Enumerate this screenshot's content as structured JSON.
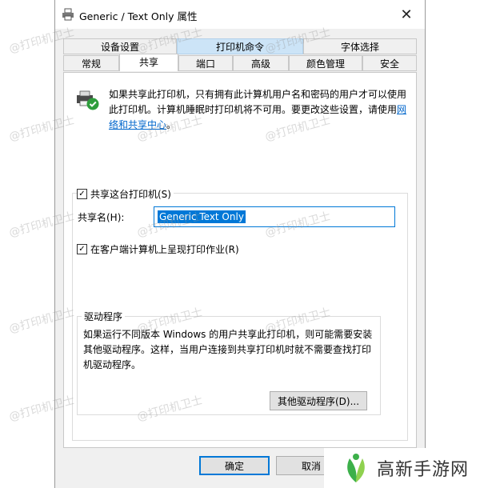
{
  "window": {
    "title": "Generic / Text Only 属性",
    "close_glyph": "✕"
  },
  "tabs": {
    "row1": [
      "设备设置",
      "打印机命令",
      "字体选择"
    ],
    "row2": [
      "常规",
      "共享",
      "端口",
      "高级",
      "颜色管理",
      "安全"
    ],
    "active": "共享",
    "highlighted": "打印机命令"
  },
  "intro": {
    "text": "如果共享此打印机，只有拥有此计算机用户名和密码的用户才可以使用此打印机。计算机睡眠时打印机将不可用。要更改这些设置，请使用",
    "link": "网络和共享中心",
    "suffix": "。"
  },
  "share": {
    "checkbox_label": "共享这台打印机(S)",
    "checked": true,
    "name_label": "共享名(H):",
    "name_value": "Generic  Text Only"
  },
  "render": {
    "checkbox_label": "在客户端计算机上呈现打印作业(R)",
    "checked": true
  },
  "driver": {
    "legend": "驱动程序",
    "text": "如果运行不同版本 Windows 的用户共享此打印机，则可能需要安装其他驱动程序。这样，当用户连接到共享打印机时就不需要查找打印机驱动程序。",
    "button": "其他驱动程序(D)..."
  },
  "buttons": {
    "ok": "确定",
    "cancel": "取消"
  },
  "watermark": "@打印机卫士",
  "logo": {
    "text": "高新手游网"
  },
  "colors": {
    "accent": "#0078d7",
    "link": "#0066cc",
    "logo_green": "#3cb04a"
  }
}
